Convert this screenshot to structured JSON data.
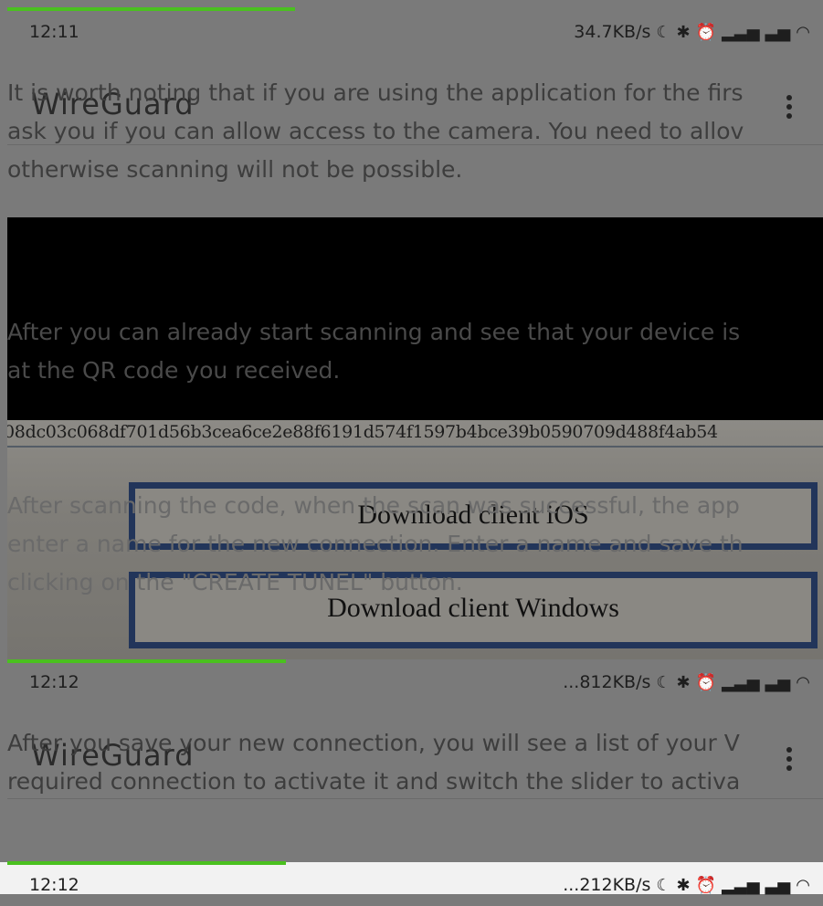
{
  "screens": [
    {
      "time": "12:11",
      "status_right": "34.7KB/s",
      "app_title": "WireGuard"
    },
    {
      "time": "12:12",
      "status_right": "...812KB/s",
      "app_title": "WireGuard"
    },
    {
      "time": "12:12",
      "status_right": "...212KB/s"
    }
  ],
  "status_icons": [
    "moon-icon",
    "bluetooth-icon",
    "alarm-icon",
    "signal-icon",
    "signal-roaming-icon",
    "wifi-icon"
  ],
  "paragraphs": {
    "p1_line1": "It is worth noting that if you are using the application for the firs",
    "p1_line2": "ask you if you can allow access to the camera. You need to allov",
    "p1_line3": "otherwise scanning will not be possible.",
    "p2_line1": "After you can already start scanning and see that your device is",
    "p2_line2": "at the QR code you received.",
    "p3_line1": "After scanning the code, when the scan was successful, the app",
    "p3_line2": "enter a name for the new connection. Enter a name and save th",
    "p3_line3": "clicking on the \"CREATE TUNEL\" button.",
    "p4_line1": "After you save your new connection, you will see a list of your V",
    "p4_line2": "required connection to activate it and switch the slider to activa"
  },
  "photo": {
    "hash_text": "08dc03c068df701d56b3cea6ce2e88f6191d574f1597b4bce39b0590709d488f4ab54",
    "button_ios": "Download client iOS",
    "button_windows": "Download client Windows"
  },
  "colors": {
    "accent_green": "#4ac01f",
    "background_gray": "#7a7a7a",
    "frame_blue": "#22355a"
  }
}
